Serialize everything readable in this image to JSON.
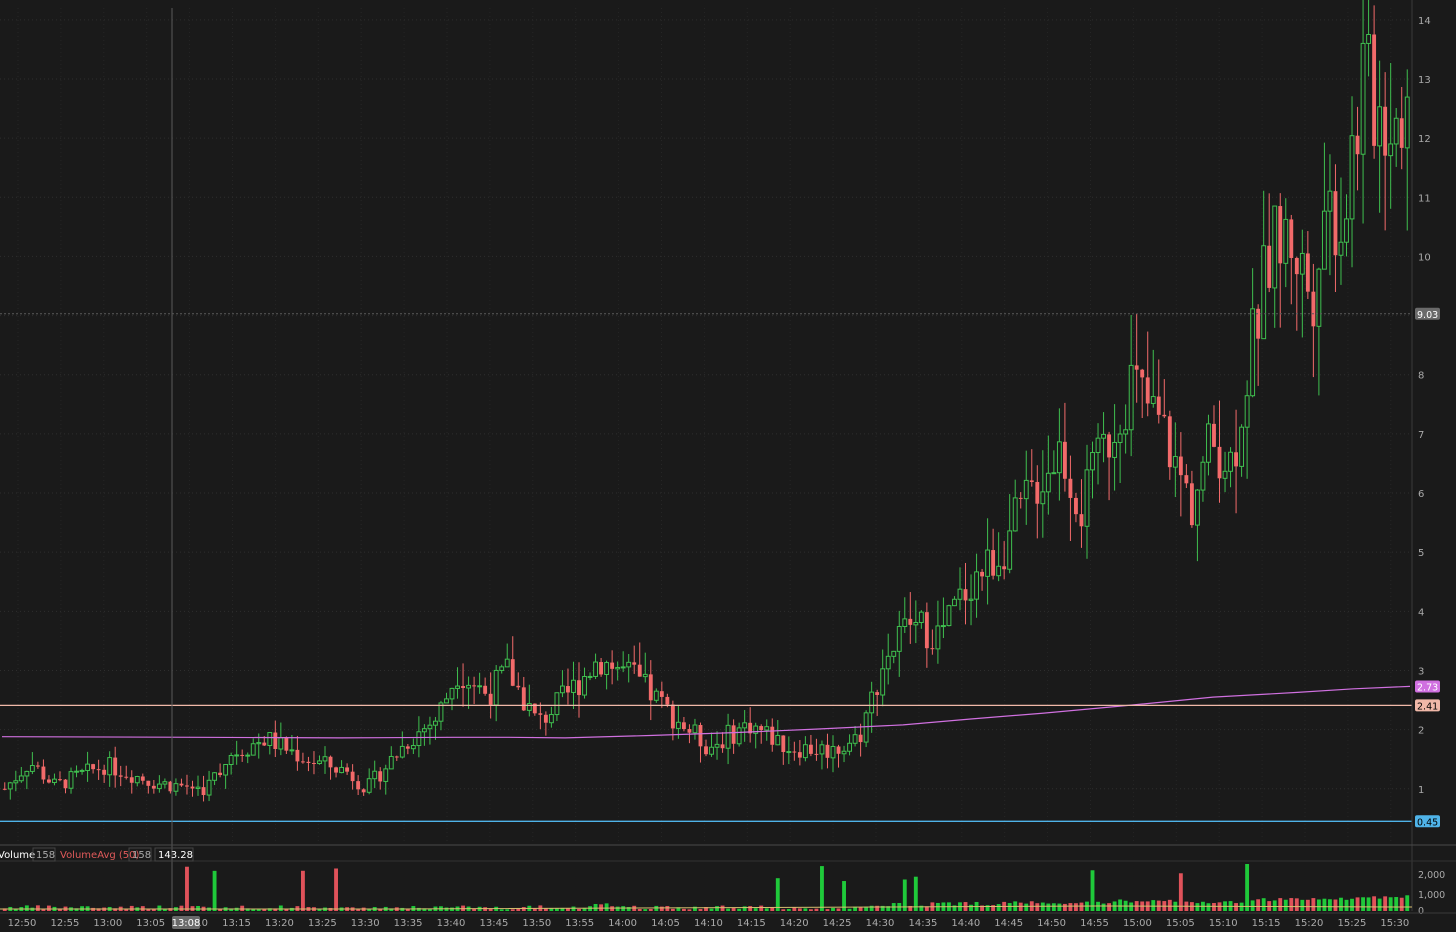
{
  "chart_data": {
    "type": "candlestick",
    "x_ticks": [
      "12:50",
      "12:55",
      "13:00",
      "13:05",
      "13:10",
      "13:15",
      "13:20",
      "13:25",
      "13:30",
      "13:35",
      "13:40",
      "13:45",
      "13:50",
      "13:55",
      "14:00",
      "14:05",
      "14:10",
      "14:15",
      "14:20",
      "14:25",
      "14:30",
      "14:35",
      "14:40",
      "14:45",
      "14:50",
      "14:55",
      "15:00",
      "15:05",
      "15:10",
      "15:15",
      "15:20",
      "15:25",
      "15:30"
    ],
    "y_ticks": [
      1,
      2,
      3,
      4,
      5,
      6,
      7,
      8,
      9,
      10,
      11,
      12,
      13,
      14
    ],
    "ylim": [
      0.1,
      14.2
    ],
    "crosshair": {
      "time_label": "13:08",
      "price_label": "9.03",
      "price": 9.03
    },
    "levels": [
      {
        "name": "level",
        "price": 2.41,
        "label": "2.41",
        "color": "#f0b8a8"
      },
      {
        "name": "level",
        "price": 0.45,
        "label": "0.45",
        "color": "#4fb3e8"
      }
    ],
    "moving_average": {
      "label": "2.73",
      "color": "#d070e0",
      "points": [
        [
          0,
          1.88
        ],
        [
          35,
          1.87
        ],
        [
          60,
          1.86
        ],
        [
          80,
          1.87
        ],
        [
          90,
          1.87
        ],
        [
          100,
          1.86
        ],
        [
          115,
          1.9
        ],
        [
          130,
          1.95
        ],
        [
          145,
          2.01
        ],
        [
          160,
          2.08
        ],
        [
          172,
          2.18
        ],
        [
          185,
          2.28
        ],
        [
          200,
          2.41
        ],
        [
          215,
          2.55
        ],
        [
          230,
          2.63
        ],
        [
          240,
          2.69
        ],
        [
          250,
          2.73
        ]
      ]
    },
    "series_up_color": "#3fbf4f",
    "series_down_color": "#f26a6a",
    "volume_panel": {
      "title": "Volume",
      "value": "158",
      "avg_label": "VolumeAvg (50)",
      "avg_value": "158",
      "extra": "143.28",
      "y_ticks": [
        "2,000",
        "1,000",
        "0"
      ]
    }
  }
}
